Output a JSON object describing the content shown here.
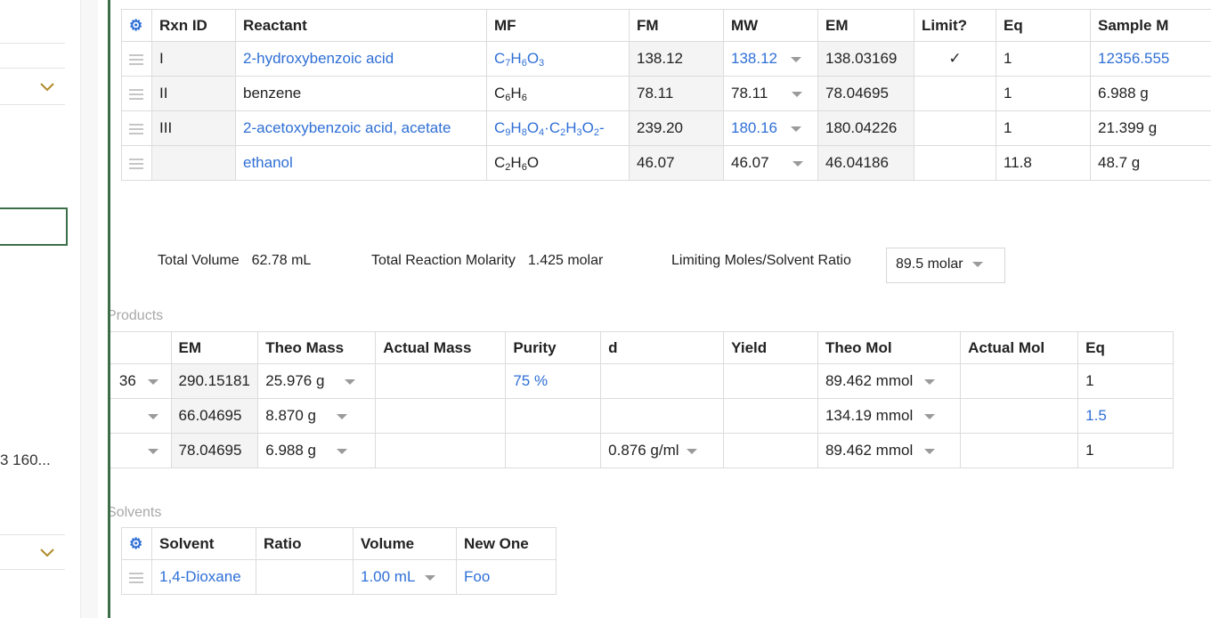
{
  "sidebar": {
    "truncated_text": "3 160..."
  },
  "summary": {
    "total_volume_label": "Total Volume",
    "total_volume_value": "62.78 mL",
    "molarity_label": "Total Reaction Molarity",
    "molarity_value": "1.425 molar",
    "ratio_label": "Limiting Moles/Solvent Ratio",
    "ratio_value": "89.5 molar"
  },
  "reactants": {
    "headers": [
      "Rxn ID",
      "Reactant",
      "MF",
      "FM",
      "MW",
      "EM",
      "Limit?",
      "Eq",
      "Sample M"
    ],
    "rows": [
      {
        "rxn_id": "I",
        "reactant": "2-hydroxybenzoic acid",
        "mf": "C7H6O3",
        "fm": "138.12",
        "mw": "138.12",
        "em": "138.03169",
        "limit": "✓",
        "eq": "1",
        "sample": "12356.555"
      },
      {
        "rxn_id": "II",
        "reactant": "benzene",
        "mf": "C6H6",
        "fm": "78.11",
        "mw": "78.11",
        "em": "78.04695",
        "limit": "",
        "eq": "1",
        "sample": "6.988 g"
      },
      {
        "rxn_id": "III",
        "reactant": "2-acetoxybenzoic acid, acetate",
        "mf": "C9H8O4·C2H3O2-",
        "fm": "239.20",
        "mw": "180.16",
        "em": "180.04226",
        "limit": "",
        "eq": "1",
        "sample": "21.399 g"
      },
      {
        "rxn_id": "",
        "reactant": "ethanol",
        "mf": "C2H6O",
        "fm": "46.07",
        "mw": "46.07",
        "em": "46.04186",
        "limit": "",
        "eq": "11.8",
        "sample": "48.7 g"
      }
    ]
  },
  "products": {
    "section_label": "Products",
    "headers": [
      "EM",
      "Theo Mass",
      "Actual Mass",
      "Purity",
      "d",
      "Yield",
      "Theo Mol",
      "Actual Mol",
      "Eq"
    ],
    "rows": [
      {
        "cut": "36",
        "em": "290.15181",
        "theo_mass": "25.976 g",
        "actual_mass": "",
        "purity": "75 %",
        "d": "",
        "yield": "",
        "theo_mol": "89.462 mmol",
        "actual_mol": "",
        "eq": "1"
      },
      {
        "cut": "",
        "em": "66.04695",
        "theo_mass": "8.870 g",
        "actual_mass": "",
        "purity": "",
        "d": "",
        "yield": "",
        "theo_mol": "134.19 mmol",
        "actual_mol": "",
        "eq": "1.5"
      },
      {
        "cut": "",
        "em": "78.04695",
        "theo_mass": "6.988 g",
        "actual_mass": "",
        "purity": "",
        "d": "0.876 g/ml",
        "yield": "",
        "theo_mol": "89.462 mmol",
        "actual_mol": "",
        "eq": "1"
      }
    ]
  },
  "solvents": {
    "section_label": "Solvents",
    "headers": [
      "Solvent",
      "Ratio",
      "Volume",
      "New One"
    ],
    "rows": [
      {
        "solvent": "1,4-Dioxane",
        "ratio": "",
        "volume": "1.00 mL",
        "new_one": "Foo"
      }
    ]
  }
}
